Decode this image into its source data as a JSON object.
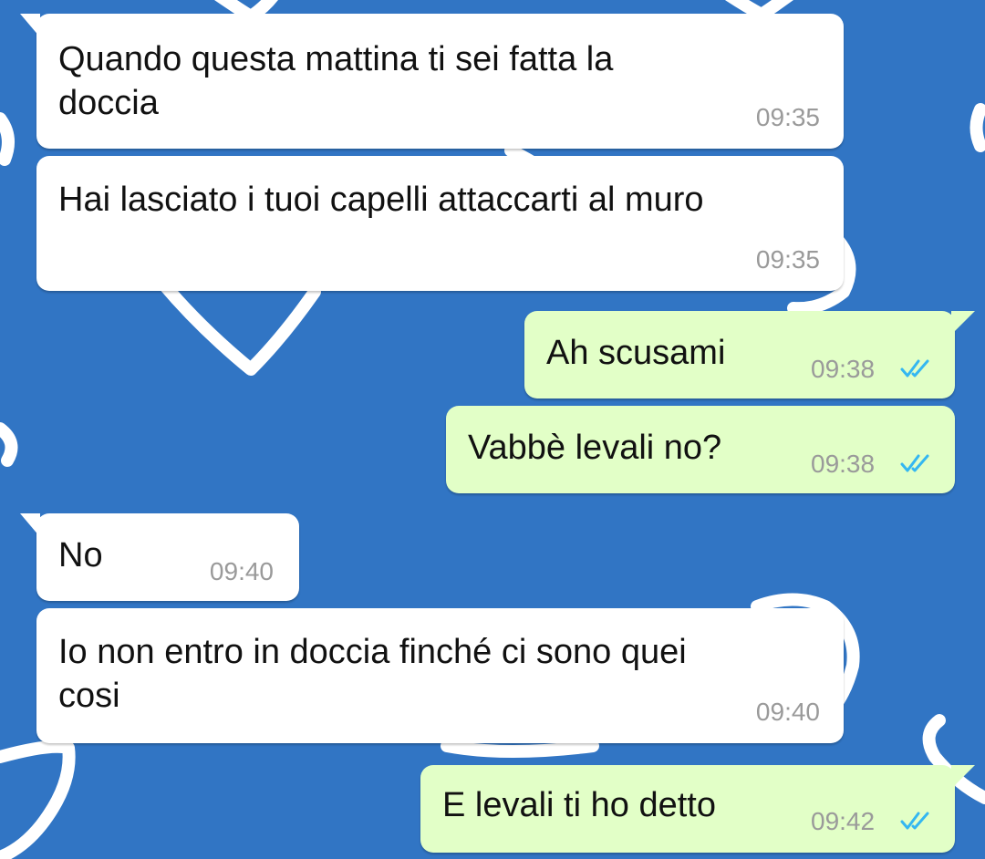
{
  "chat": {
    "messages": [
      {
        "direction": "in",
        "text": "Quando questa mattina ti sei fatta la\ndoccia",
        "time": "09:35"
      },
      {
        "direction": "in",
        "text": "Hai lasciato i tuoi capelli attaccarti al muro",
        "time": "09:35"
      },
      {
        "direction": "out",
        "text": "Ah scusami",
        "time": "09:38",
        "status": "read"
      },
      {
        "direction": "out",
        "text": "Vabbè levali no?",
        "time": "09:38",
        "status": "read"
      },
      {
        "direction": "in",
        "text": "No",
        "time": "09:40"
      },
      {
        "direction": "in",
        "text": "Io non entro in doccia finché ci sono quei\ncosi",
        "time": "09:40"
      },
      {
        "direction": "out",
        "text": "E levali ti ho detto",
        "time": "09:42",
        "status": "read"
      }
    ]
  },
  "theme": {
    "wallpaper_color": "#3175c4",
    "wallpaper_pattern": "white heart outlines",
    "incoming_bubble_color": "#ffffff",
    "outgoing_bubble_color": "#e2ffc7",
    "read_tick_color": "#34b7f1",
    "read_status_icon": "double-check-icon"
  }
}
